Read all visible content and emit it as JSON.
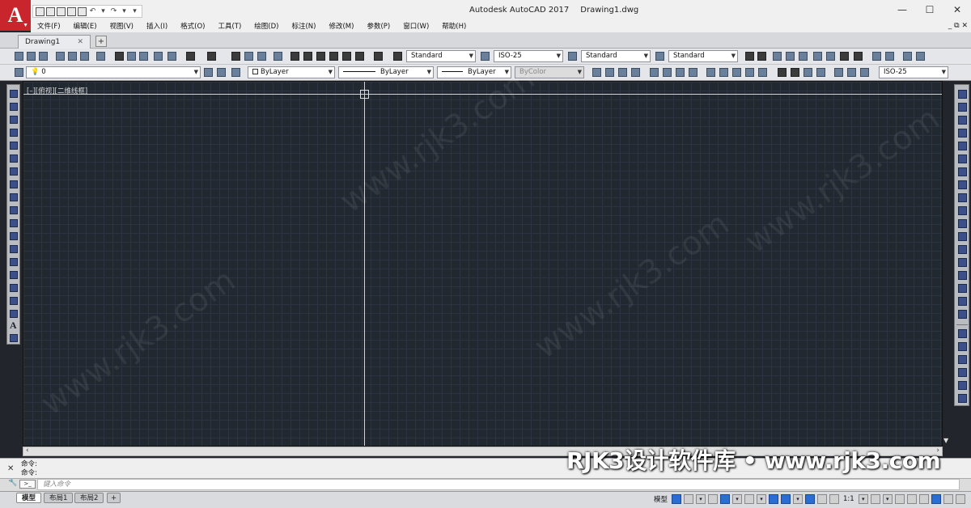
{
  "window": {
    "app_name": "Autodesk AutoCAD 2017",
    "file_name": "Drawing1.dwg",
    "logo_letter": "A",
    "controls": [
      "—",
      "☐",
      "✕"
    ]
  },
  "menubar": {
    "items": [
      "文件(F)",
      "编辑(E)",
      "视图(V)",
      "插入(I)",
      "格式(O)",
      "工具(T)",
      "绘图(D)",
      "标注(N)",
      "修改(M)",
      "参数(P)",
      "窗口(W)",
      "帮助(H)"
    ],
    "mdi_controls": "_ ⧉ ✕"
  },
  "tabs": {
    "document": "Drawing1",
    "close": "✕",
    "new": "+"
  },
  "toolbar1": {
    "text_style": "Standard",
    "dim_style": "ISO-25",
    "table_style": "Standard",
    "mleader_style": "Standard"
  },
  "toolbar2": {
    "layer": "0",
    "color": "ByLayer",
    "linetype": "ByLayer",
    "lineweight": "ByLayer",
    "plot_style": "ByColor",
    "dim_style": "ISO-25"
  },
  "viewport": {
    "label": "[–][俯视][二维线框]"
  },
  "left_toolbar": {
    "text_tool": "A"
  },
  "command": {
    "history": [
      "命令:",
      "命令:"
    ],
    "placeholder": "键入命令",
    "prompt_icon": ">_"
  },
  "layouts": {
    "tabs": [
      "模型",
      "布局1",
      "布局2"
    ],
    "active": "模型",
    "add": "+"
  },
  "status": {
    "model_label": "模型",
    "scale": "1:1"
  },
  "watermark": {
    "text": "www.rjk3.com",
    "brand": "RJK3设计软件库 • www.rjk3.com"
  }
}
